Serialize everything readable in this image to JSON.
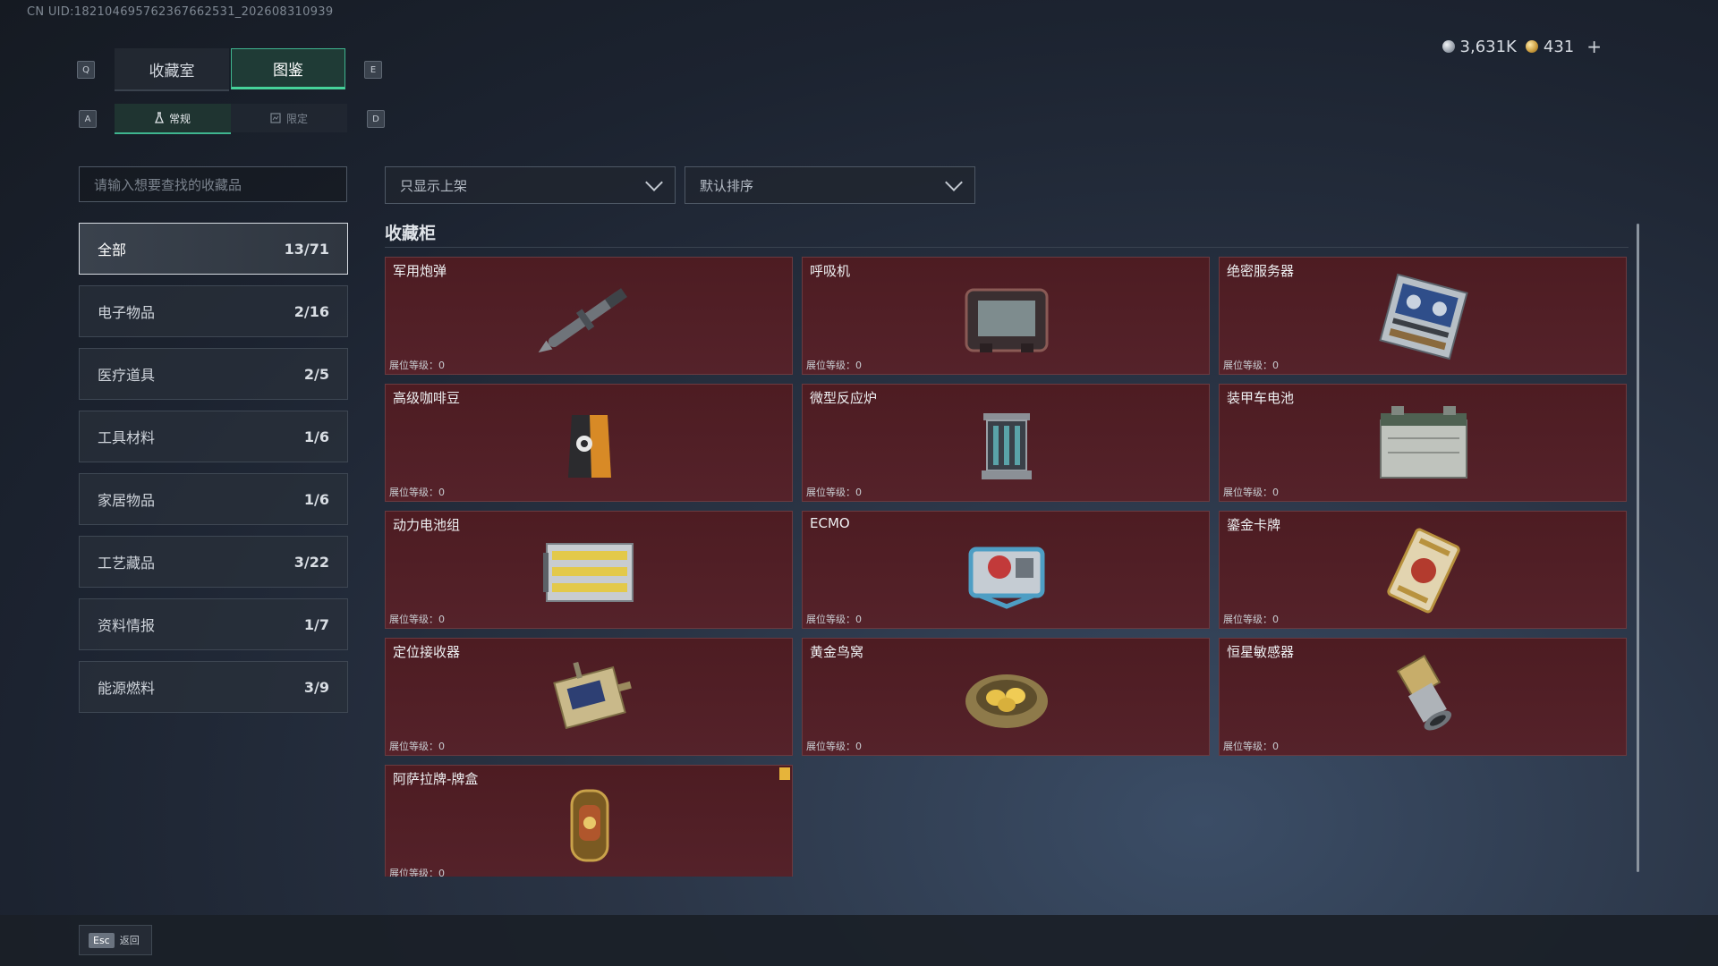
{
  "uid": "CN UID:182104695762367662531_202608310939",
  "currency": {
    "silver": "3,631K",
    "gold": "431",
    "plus": "+"
  },
  "keys": {
    "prev_tab": "Q",
    "next_tab": "E",
    "prev_sub": "A",
    "next_sub": "D"
  },
  "tabs": {
    "collection_room": "收藏室",
    "catalog": "图鉴"
  },
  "subtabs": {
    "regular": "常规",
    "limited": "限定"
  },
  "search": {
    "placeholder": "请输入想要查找的收藏品"
  },
  "filters": {
    "display": "只显示上架",
    "sort": "默认排序"
  },
  "categories": [
    {
      "label": "全部",
      "count": "13/71"
    },
    {
      "label": "电子物品",
      "count": "2/16"
    },
    {
      "label": "医疗道具",
      "count": "2/5"
    },
    {
      "label": "工具材料",
      "count": "1/6"
    },
    {
      "label": "家居物品",
      "count": "1/6"
    },
    {
      "label": "工艺藏品",
      "count": "3/22"
    },
    {
      "label": "资料情报",
      "count": "1/7"
    },
    {
      "label": "能源燃料",
      "count": "3/9"
    }
  ],
  "section_title": "收藏柜",
  "items": [
    {
      "name": "军用炮弹",
      "level": "展位等级：0",
      "icon": "shell-icon"
    },
    {
      "name": "呼吸机",
      "level": "展位等级：0",
      "icon": "ventilator-icon"
    },
    {
      "name": "绝密服务器",
      "level": "展位等级：0",
      "icon": "server-icon"
    },
    {
      "name": "高级咖啡豆",
      "level": "展位等级：0",
      "icon": "coffee-bag-icon"
    },
    {
      "name": "微型反应炉",
      "level": "展位等级：0",
      "icon": "reactor-icon"
    },
    {
      "name": "装甲车电池",
      "level": "展位等级：0",
      "icon": "battery-icon"
    },
    {
      "name": "动力电池组",
      "level": "展位等级：0",
      "icon": "battery-pack-icon"
    },
    {
      "name": "ECMO",
      "level": "展位等级：0",
      "icon": "ecmo-icon"
    },
    {
      "name": "鎏金卡牌",
      "level": "展位等级：0",
      "icon": "card-icon"
    },
    {
      "name": "定位接收器",
      "level": "展位等级：0",
      "icon": "receiver-icon"
    },
    {
      "name": "黄金鸟窝",
      "level": "展位等级：0",
      "icon": "nest-icon"
    },
    {
      "name": "恒星敏感器",
      "level": "展位等级：0",
      "icon": "sensor-icon"
    },
    {
      "name": "阿萨拉牌-牌盒",
      "level": "展位等级：0",
      "icon": "card-box-icon"
    }
  ],
  "footer": {
    "esc_key": "Esc",
    "back_label": "返回"
  }
}
